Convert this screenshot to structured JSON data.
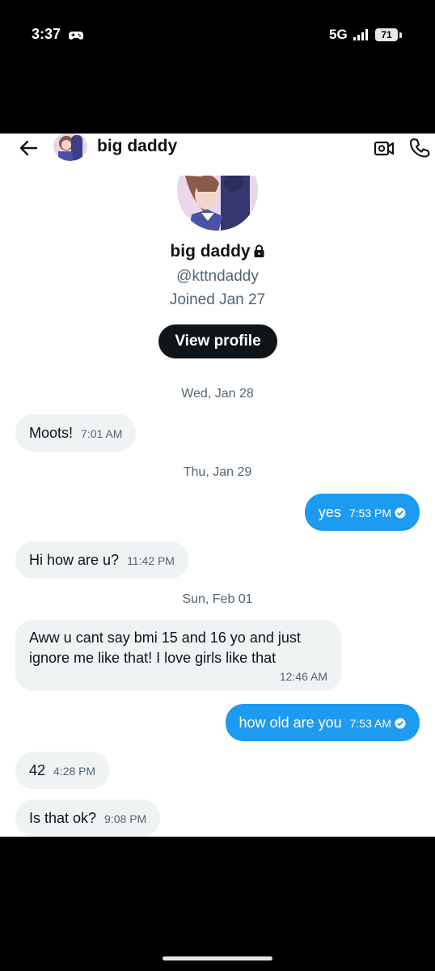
{
  "status_bar": {
    "time": "3:37",
    "network": "5G",
    "battery": "71"
  },
  "header": {
    "title": "big daddy"
  },
  "profile": {
    "name": "big daddy",
    "handle": "@kttndaddy",
    "joined": "Joined Jan 27",
    "view_profile_label": "View profile"
  },
  "dates": [
    "Wed, Jan 28",
    "Thu, Jan 29",
    "Sun, Feb 01"
  ],
  "messages": [
    {
      "direction": "in",
      "text": "Moots!",
      "time": "7:01 AM"
    },
    {
      "direction": "out",
      "text": "yes",
      "time": "7:53 PM"
    },
    {
      "direction": "in",
      "text": "Hi how are u?",
      "time": "11:42 PM"
    },
    {
      "direction": "in",
      "text": "Aww u cant say bmi 15 and 16 yo and just ignore me like that! I love girls like that",
      "time": "12:46 AM"
    },
    {
      "direction": "out",
      "text": "how old are you",
      "time": "7:53 AM"
    },
    {
      "direction": "in",
      "text": "42",
      "time": "4:28 PM"
    },
    {
      "direction": "in",
      "text": "Is that ok?",
      "time": "9:08 PM"
    }
  ],
  "colors": {
    "accent": "#1d9bf0",
    "bubble_in": "#eff3f4",
    "text": "#0f1419",
    "muted": "#536471"
  }
}
